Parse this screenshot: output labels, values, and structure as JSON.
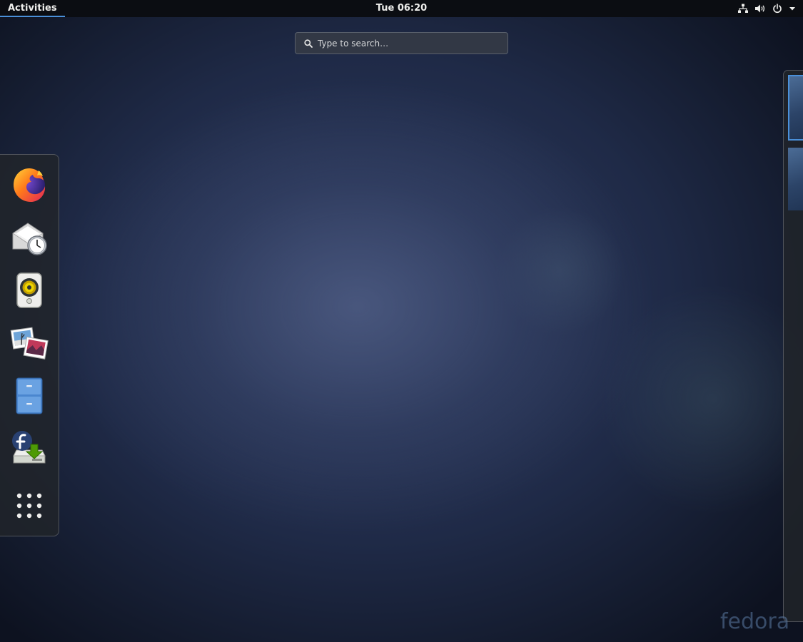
{
  "topbar": {
    "activities_label": "Activities",
    "clock": "Tue 06:20",
    "status_icons": [
      "network-wired-icon",
      "volume-high-icon",
      "power-icon",
      "dropdown-arrow-icon"
    ]
  },
  "search": {
    "placeholder": "Type to search…",
    "value": ""
  },
  "dash": {
    "apps": [
      {
        "name": "Firefox",
        "icon": "firefox-icon"
      },
      {
        "name": "Evolution",
        "icon": "evolution-mail-icon"
      },
      {
        "name": "Rhythmbox",
        "icon": "rhythmbox-icon"
      },
      {
        "name": "Photos",
        "icon": "photos-icon"
      },
      {
        "name": "Files",
        "icon": "files-cabinet-icon"
      },
      {
        "name": "Fedora Media Writer",
        "icon": "fedora-install-icon"
      }
    ],
    "show_apps_icon": "show-applications-icon"
  },
  "workspaces": {
    "count": 2,
    "active_index": 0
  },
  "wallpaper": {
    "logo_text": "fedora"
  },
  "colors": {
    "accent": "#4a90d9",
    "topbar": "#0b0d12",
    "dash_bg": "#21242a"
  }
}
